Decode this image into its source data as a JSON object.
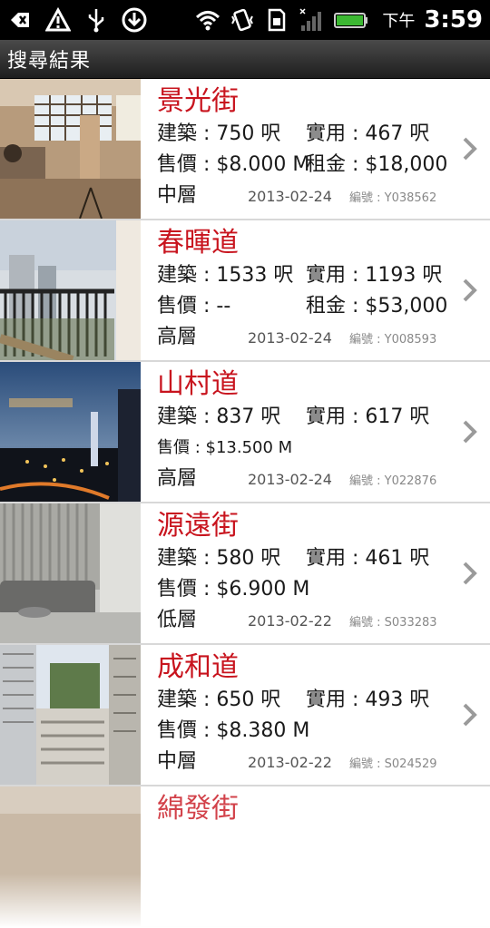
{
  "status": {
    "ampm": "下午",
    "time": "3:59"
  },
  "title": "搜尋結果",
  "labels": {
    "gross": "建築 : ",
    "net": "實用 : ",
    "sale": "售價 : ",
    "rent": "租金 : ",
    "ref": "編號 : "
  },
  "listings": [
    {
      "street": "景光街",
      "gross": "750 呎",
      "net": "467 呎",
      "sale": "$8.000 M",
      "rent": "$18,000",
      "floor": "中層",
      "date": "2013-02-24",
      "ref": "Y038562"
    },
    {
      "street": "春暉道",
      "gross": "1533 呎",
      "net": "1193 呎",
      "sale": "--",
      "rent": "$53,000",
      "floor": "高層",
      "date": "2013-02-24",
      "ref": "Y008593"
    },
    {
      "street": "山村道",
      "gross": "837 呎",
      "net": "617 呎",
      "sale": "$13.500 M",
      "floor": "高層",
      "date": "2013-02-24",
      "ref": "Y022876"
    },
    {
      "street": "源遠街",
      "gross": "580 呎",
      "net": "461 呎",
      "sale": "$6.900 M",
      "floor": "低層",
      "date": "2013-02-22",
      "ref": "S033283"
    },
    {
      "street": "成和道",
      "gross": "650 呎",
      "net": "493 呎",
      "sale": "$8.380 M",
      "floor": "中層",
      "date": "2013-02-22",
      "ref": "S024529"
    },
    {
      "street": "綿發街"
    }
  ],
  "icons": [
    "back-icon",
    "warning-icon",
    "usb-icon",
    "download-icon",
    "wifi-icon",
    "vibrate-icon",
    "sd-card-icon",
    "signal-icon",
    "battery-icon",
    "chevron-right-icon"
  ],
  "colors": {
    "street": "#c8141e",
    "titlebar": "#2a2a2a",
    "battery": "#3cb832"
  }
}
